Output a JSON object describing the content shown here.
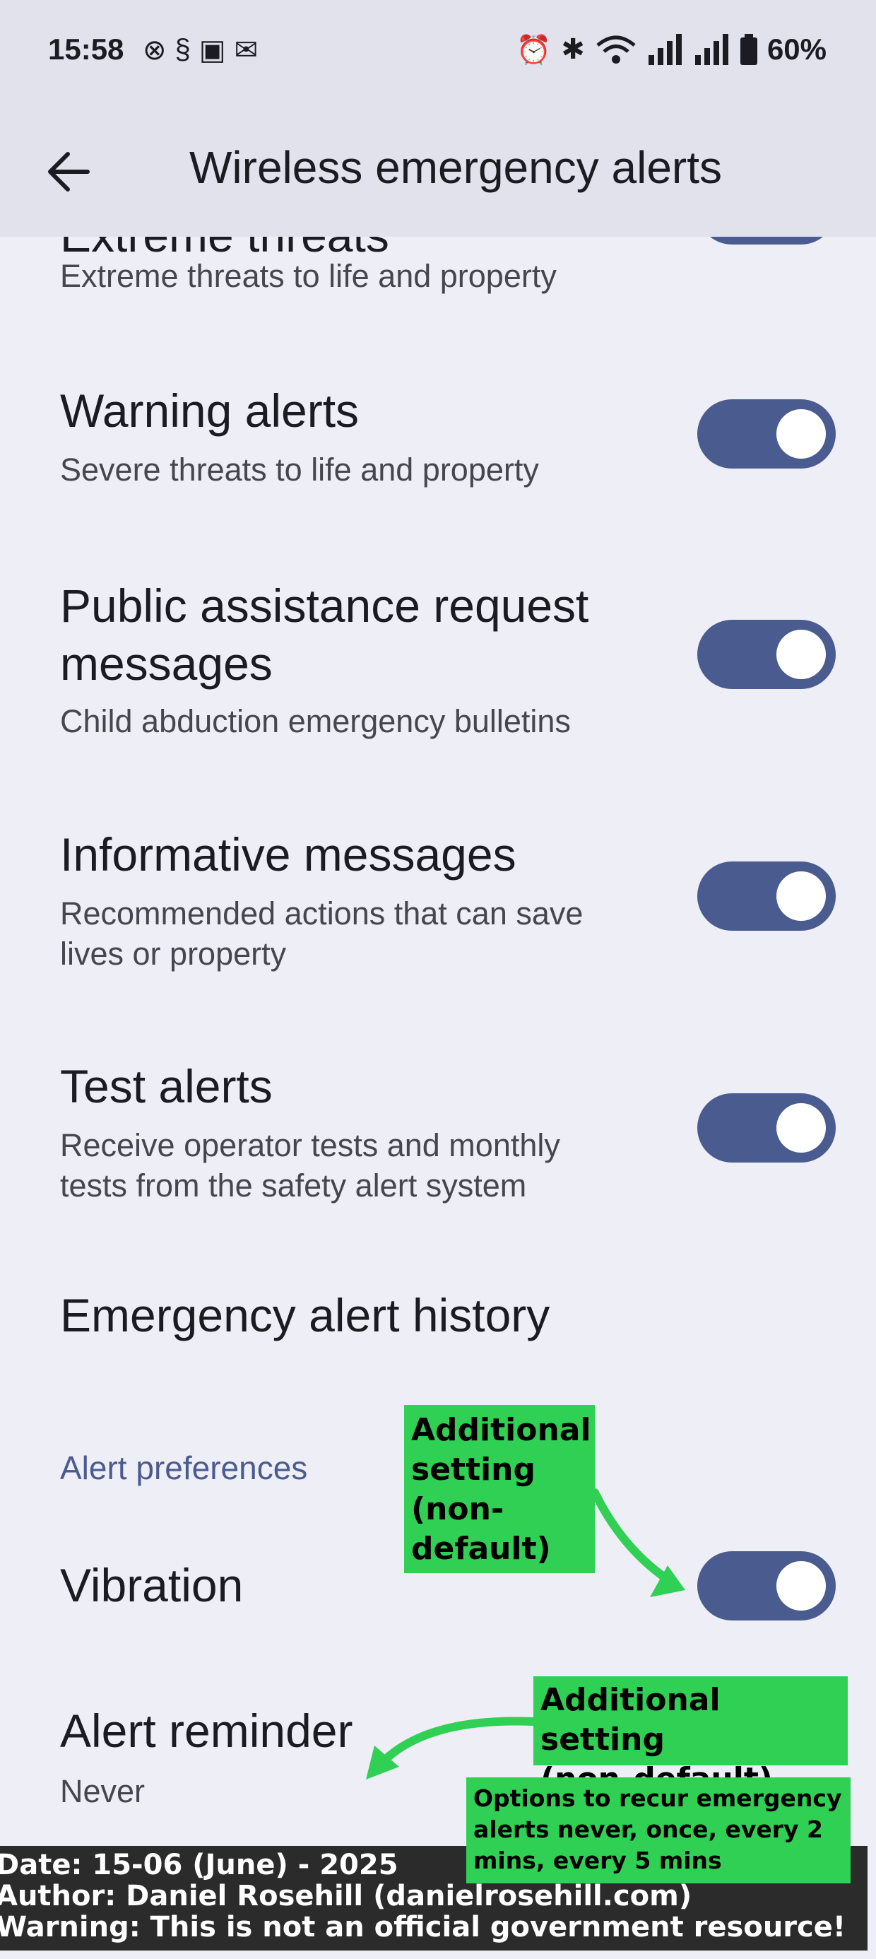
{
  "status_bar": {
    "time": "15:58",
    "battery": "60%",
    "left_icons": [
      "x-icon",
      "s-icon",
      "image-icon",
      "mail-icon"
    ],
    "right_icons": [
      "alarm-icon",
      "bluetooth-icon",
      "wifi-icon",
      "signal-icon",
      "signal-icon",
      "battery-icon"
    ]
  },
  "app_bar": {
    "title": "Wireless emergency alerts",
    "back_icon": "arrow-back-icon"
  },
  "settings": [
    {
      "title": "Extreme threats",
      "subtitle": "Extreme threats to life and property",
      "enabled": true
    },
    {
      "title": "Warning alerts",
      "subtitle": "Severe threats to life and property",
      "enabled": true
    },
    {
      "title_line1": "Public assistance request",
      "title_line2": "messages",
      "subtitle": "Child abduction emergency bulletins",
      "enabled": true
    },
    {
      "title": "Informative messages",
      "subtitle_line1": "Recommended actions that can save",
      "subtitle_line2": "lives or property",
      "enabled": true
    },
    {
      "title": "Test alerts",
      "subtitle_line1": "Receive operator tests and monthly",
      "subtitle_line2": "tests from the safety alert system",
      "enabled": true
    }
  ],
  "history": {
    "title": "Emergency alert history"
  },
  "preferences": {
    "section_title": "Alert preferences",
    "vibration": {
      "title": "Vibration",
      "enabled": true
    },
    "alert_reminder": {
      "title": "Alert reminder",
      "value": "Never"
    }
  },
  "annotations": {
    "vibration_note": [
      "Additional",
      "setting",
      "(non-",
      "default)"
    ],
    "reminder_note": [
      "Additional setting",
      "(non-default)"
    ],
    "options_note": [
      "Options to recur emergency",
      "alerts never, once, every 2",
      "mins, every 5 mins"
    ],
    "annotation_color": "#2fd054"
  },
  "footer": {
    "line1": "Date: 15-06 (June) - 2025",
    "line2": "Author: Daniel Rosehill (danielrosehill.com)",
    "line3": "Warning: This is not an official government resource!"
  },
  "colors": {
    "background": "#eeeef6",
    "app_bar": "#e2e2ec",
    "toggle_on": "#4a5b8f",
    "accent_text": "#4a5b8f"
  }
}
